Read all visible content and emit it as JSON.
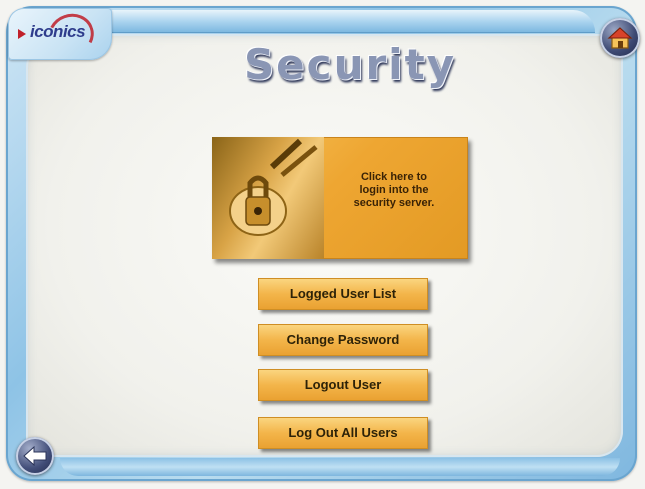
{
  "header": {
    "logo_text": "iconics",
    "title": "Security"
  },
  "login": {
    "text": "Click here to\nlogin into the\nsecurity server."
  },
  "actions": {
    "logged_user_list": "Logged User List",
    "change_password": "Change Password",
    "logout_user": "Logout User",
    "log_out_all_users": "Log Out All Users"
  },
  "icons": {
    "home": "home-icon",
    "back": "back-arrow-icon",
    "login": "lock-key-icon"
  },
  "colors": {
    "frame": "#8ec3e6",
    "button": "#f3b54a",
    "title": "#8a96b4",
    "brand_red": "#c0202a",
    "brand_blue": "#2e3c8c"
  }
}
